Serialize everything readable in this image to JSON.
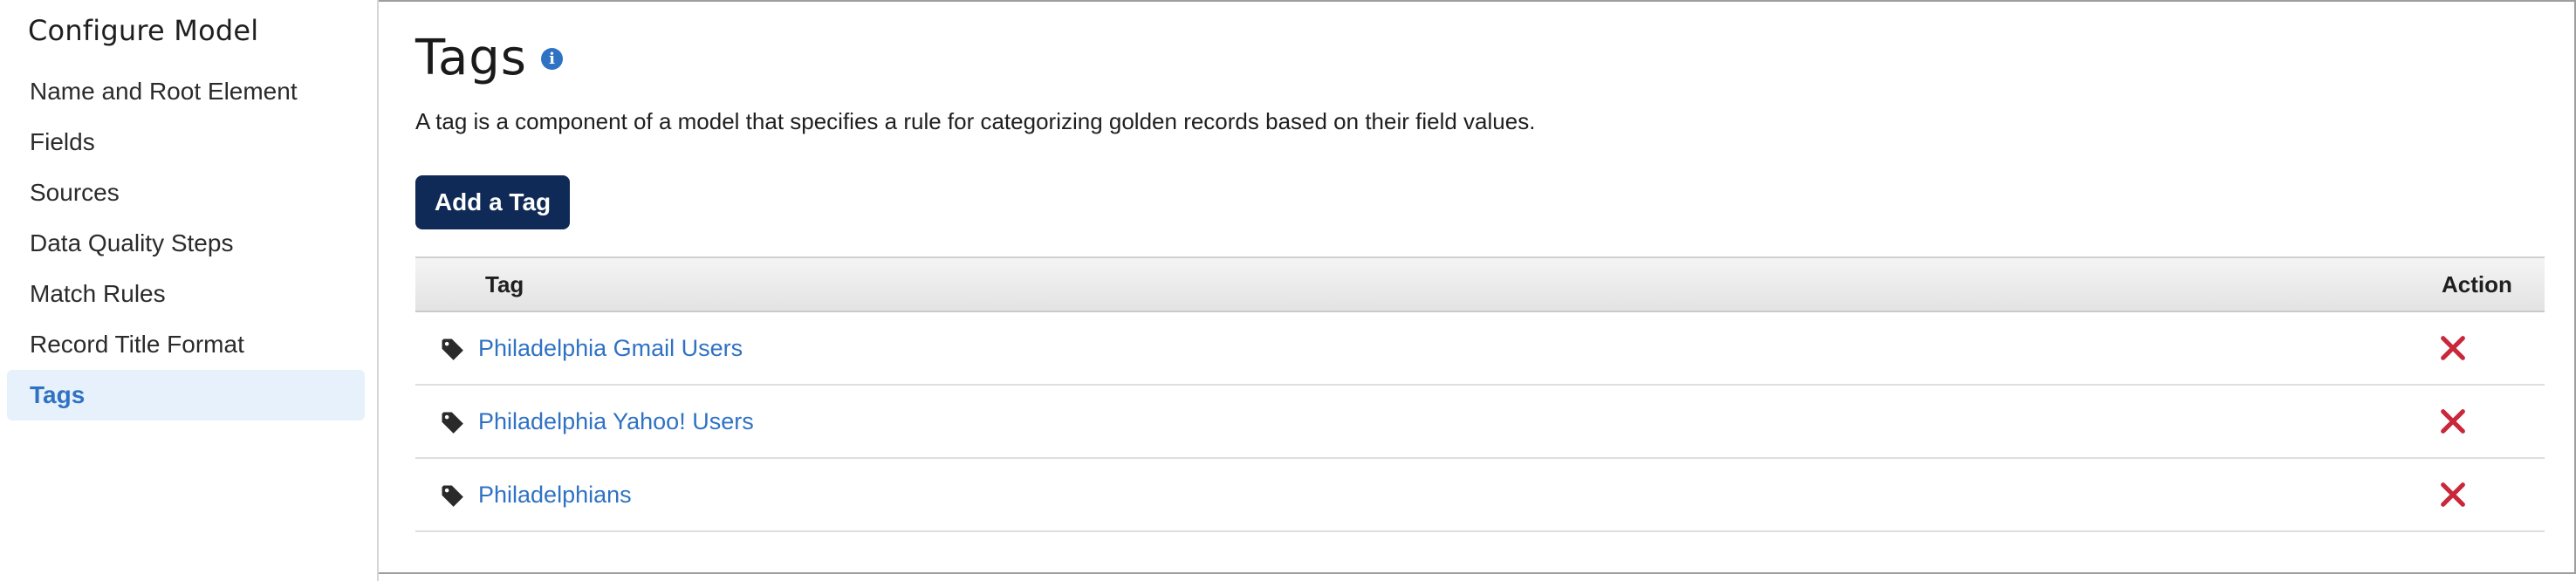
{
  "sidebar": {
    "title": "Configure Model",
    "items": [
      {
        "label": "Name and Root Element",
        "active": false
      },
      {
        "label": "Fields",
        "active": false
      },
      {
        "label": "Sources",
        "active": false
      },
      {
        "label": "Data Quality Steps",
        "active": false
      },
      {
        "label": "Match Rules",
        "active": false
      },
      {
        "label": "Record Title Format",
        "active": false
      },
      {
        "label": "Tags",
        "active": true
      }
    ]
  },
  "main": {
    "title": "Tags",
    "info_icon": "info-icon",
    "description": "A tag is a component of a model that specifies a rule for categorizing golden records based on their field values.",
    "add_button_label": "Add a Tag"
  },
  "table": {
    "columns": [
      "Tag",
      "Action"
    ],
    "rows": [
      {
        "tag": "Philadelphia Gmail Users",
        "icon": "tag-icon",
        "action_icon": "delete-icon"
      },
      {
        "tag": "Philadelphia Yahoo! Users",
        "icon": "tag-icon",
        "action_icon": "delete-icon"
      },
      {
        "tag": "Philadelphians",
        "icon": "tag-icon",
        "action_icon": "delete-icon"
      }
    ]
  },
  "colors": {
    "accent": "#2f72c4",
    "button_bg": "#0f2a57",
    "active_nav_bg": "#e6f1fb",
    "delete": "#c8283a"
  }
}
